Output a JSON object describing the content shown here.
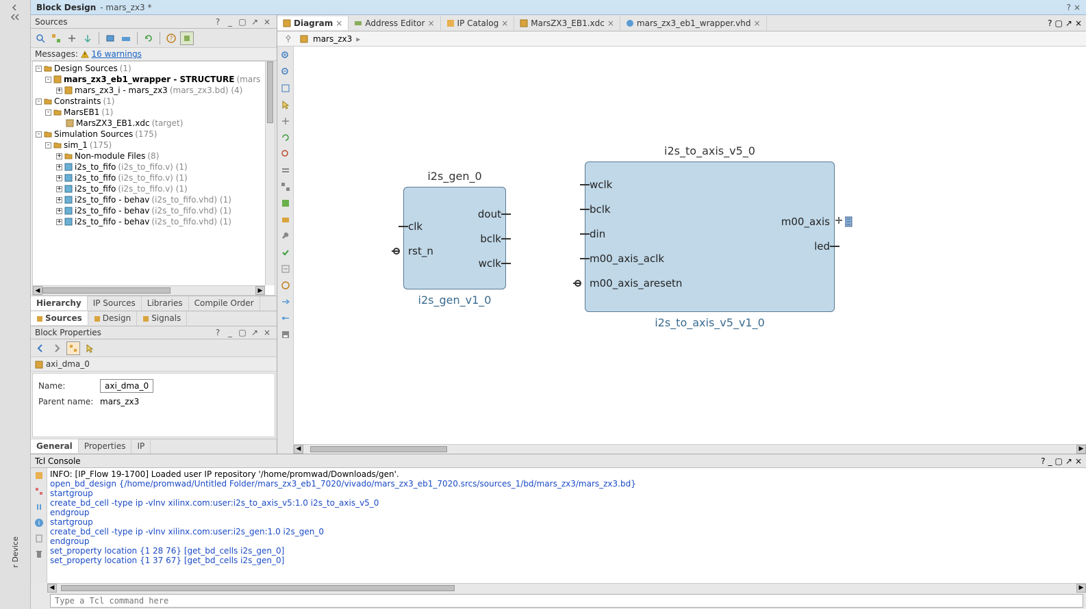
{
  "title": {
    "main": "Block Design",
    "sub": "- mars_zx3 *"
  },
  "left_edge_text": "r Device",
  "sources": {
    "title": "Sources",
    "messages_label": "Messages:",
    "warnings_link": "16 warnings",
    "tree": [
      {
        "indent": 0,
        "exp": "-",
        "icon": "folder",
        "name": "Design Sources",
        "meta": "(1)"
      },
      {
        "indent": 1,
        "exp": "-",
        "icon": "bd",
        "name": "mars_zx3_eb1_wrapper - STRUCTURE",
        "meta": "(mars",
        "bold": true
      },
      {
        "indent": 2,
        "exp": "+",
        "icon": "bd",
        "name": "mars_zx3_i - mars_zx3",
        "meta": "(mars_zx3.bd) (4)"
      },
      {
        "indent": 0,
        "exp": "-",
        "icon": "folder",
        "name": "Constraints",
        "meta": "(1)"
      },
      {
        "indent": 1,
        "exp": "-",
        "icon": "folder",
        "name": "MarsEB1",
        "meta": "(1)"
      },
      {
        "indent": 2,
        "exp": "",
        "icon": "xdc",
        "name": "MarsZX3_EB1.xdc",
        "meta": "(target)"
      },
      {
        "indent": 0,
        "exp": "-",
        "icon": "folder",
        "name": "Simulation Sources",
        "meta": "(175)"
      },
      {
        "indent": 1,
        "exp": "-",
        "icon": "folder",
        "name": "sim_1",
        "meta": "(175)"
      },
      {
        "indent": 2,
        "exp": "+",
        "icon": "folder",
        "name": "Non-module Files",
        "meta": "(8)"
      },
      {
        "indent": 2,
        "exp": "+",
        "icon": "v",
        "name": "i2s_to_fifo",
        "meta": "(i2s_to_fifo.v) (1)"
      },
      {
        "indent": 2,
        "exp": "+",
        "icon": "v",
        "name": "i2s_to_fifo",
        "meta": "(i2s_to_fifo.v) (1)"
      },
      {
        "indent": 2,
        "exp": "+",
        "icon": "v",
        "name": "i2s_to_fifo",
        "meta": "(i2s_to_fifo.v) (1)"
      },
      {
        "indent": 2,
        "exp": "+",
        "icon": "v",
        "name": "i2s_to_fifo - behav",
        "meta": "(i2s_to_fifo.vhd) (1)"
      },
      {
        "indent": 2,
        "exp": "+",
        "icon": "v",
        "name": "i2s_to_fifo - behav",
        "meta": "(i2s_to_fifo.vhd) (1)"
      },
      {
        "indent": 2,
        "exp": "+",
        "icon": "v",
        "name": "i2s_to_fifo - behav",
        "meta": "(i2s_to_fifo.vhd) (1)"
      }
    ],
    "tabs_lower": [
      "Hierarchy",
      "IP Sources",
      "Libraries",
      "Compile Order"
    ],
    "tabs_bottom": [
      "Sources",
      "Design",
      "Signals"
    ]
  },
  "block_props": {
    "title": "Block Properties",
    "breadcrumb": "axi_dma_0",
    "form": {
      "name_lbl": "Name:",
      "name_val": "axi_dma_0",
      "parent_lbl": "Parent name:",
      "parent_val": "mars_zx3"
    },
    "tabs": [
      "General",
      "Properties",
      "IP"
    ]
  },
  "editor_tabs": [
    {
      "label": "Diagram",
      "active": true
    },
    {
      "label": "Address Editor"
    },
    {
      "label": "IP Catalog"
    },
    {
      "label": "MarsZX3_EB1.xdc"
    },
    {
      "label": "mars_zx3_eb1_wrapper.vhd"
    }
  ],
  "breadcrumb_path": "mars_zx3",
  "blocks": {
    "i2s_gen": {
      "title": "i2s_gen_0",
      "subtitle": "i2s_gen_v1_0",
      "ports_left": [
        {
          "name": "clk",
          "type": "plain"
        },
        {
          "name": "rst_n",
          "type": "inv"
        }
      ],
      "ports_right": [
        {
          "name": "dout"
        },
        {
          "name": "bclk"
        },
        {
          "name": "wclk"
        }
      ]
    },
    "i2s_axis": {
      "title": "i2s_to_axis_v5_0",
      "subtitle": "i2s_to_axis_v5_v1_0",
      "ports_left": [
        {
          "name": "wclk",
          "type": "plain"
        },
        {
          "name": "bclk",
          "type": "plain"
        },
        {
          "name": "din",
          "type": "plain"
        },
        {
          "name": "m00_axis_aclk",
          "type": "plain"
        },
        {
          "name": "m00_axis_aresetn",
          "type": "inv"
        }
      ],
      "ports_right": [
        {
          "name": "m00_axis",
          "type": "iface"
        },
        {
          "name": "led",
          "type": "plain"
        }
      ]
    }
  },
  "tcl": {
    "title": "Tcl Console",
    "lines": [
      {
        "cls": "black",
        "text": "INFO: [IP_Flow 19-1700] Loaded user IP repository '/home/promwad/Downloads/gen'."
      },
      {
        "cls": "blue",
        "text": "open_bd_design {/home/promwad/Untitled Folder/mars_zx3_eb1_7020/vivado/mars_zx3_eb1_7020.srcs/sources_1/bd/mars_zx3/mars_zx3.bd}"
      },
      {
        "cls": "blue",
        "text": "startgroup"
      },
      {
        "cls": "blue",
        "text": "create_bd_cell -type ip -vlnv xilinx.com:user:i2s_to_axis_v5:1.0 i2s_to_axis_v5_0"
      },
      {
        "cls": "blue",
        "text": "endgroup"
      },
      {
        "cls": "blue",
        "text": "startgroup"
      },
      {
        "cls": "blue",
        "text": "create_bd_cell -type ip -vlnv xilinx.com:user:i2s_gen:1.0 i2s_gen_0"
      },
      {
        "cls": "blue",
        "text": "endgroup"
      },
      {
        "cls": "blue",
        "text": "set_property location {1 28 76} [get_bd_cells i2s_gen_0]"
      },
      {
        "cls": "blue",
        "text": "set_property location {1 37 67} [get_bd_cells i2s_gen_0]"
      }
    ],
    "input_placeholder": "Type a Tcl command here"
  }
}
